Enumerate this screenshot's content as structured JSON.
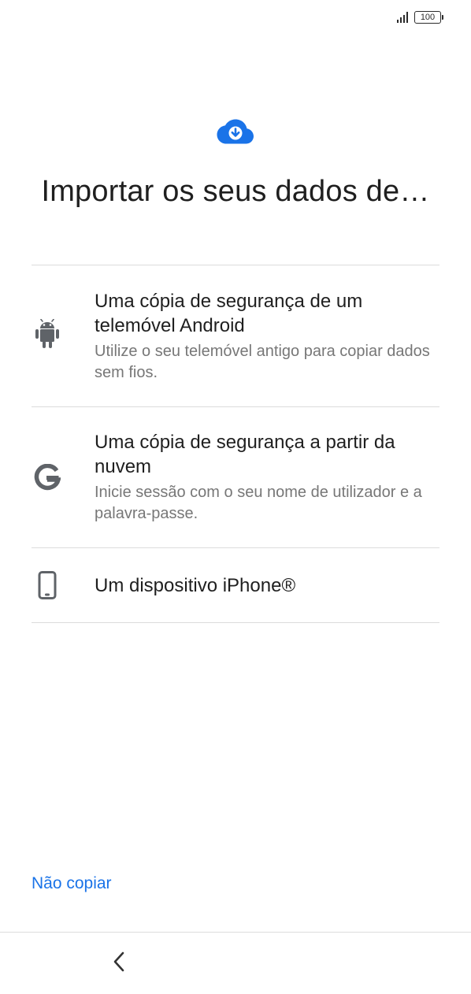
{
  "status_bar": {
    "battery_level": "100",
    "signal_icon": "signal-bars-icon"
  },
  "header": {
    "icon": "cloud-download-icon",
    "icon_color": "#1a73e8",
    "title": "Importar os seus dados de…"
  },
  "options": [
    {
      "icon": "android-icon",
      "title": "Uma cópia de segurança de um telemóvel Android",
      "description": "Utilize o seu telemóvel antigo para copiar dados sem fios."
    },
    {
      "icon": "google-g-icon",
      "title": "Uma cópia de segurança a partir da nuvem",
      "description": "Inicie sessão com o seu nome de utilizador e a palavra-passe."
    },
    {
      "icon": "phone-device-icon",
      "title": "Um dispositivo iPhone®",
      "description": ""
    }
  ],
  "footer": {
    "skip_label": "Não copiar",
    "skip_color": "#1a73e8",
    "back_icon": "chevron-left-icon"
  }
}
